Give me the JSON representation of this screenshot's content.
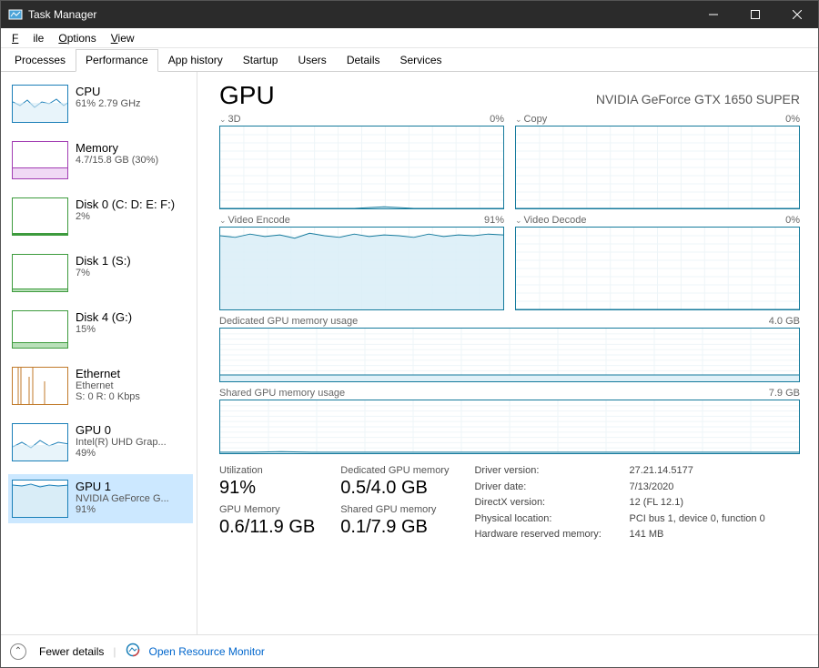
{
  "window": {
    "title": "Task Manager"
  },
  "menu": {
    "file": "File",
    "options": "Options",
    "view": "View"
  },
  "tabs": [
    "Processes",
    "Performance",
    "App history",
    "Startup",
    "Users",
    "Details",
    "Services"
  ],
  "active_tab": "Performance",
  "sidebar": [
    {
      "title": "CPU",
      "sub": "61% 2.79 GHz",
      "color": "#1a7fb8"
    },
    {
      "title": "Memory",
      "sub": "4.7/15.8 GB (30%)",
      "color": "#a23db3"
    },
    {
      "title": "Disk 0 (C: D: E: F:)",
      "sub": "2%",
      "color": "#3d9b3d"
    },
    {
      "title": "Disk 1 (S:)",
      "sub": "7%",
      "color": "#3d9b3d"
    },
    {
      "title": "Disk 4 (G:)",
      "sub": "15%",
      "color": "#3d9b3d"
    },
    {
      "title": "Ethernet",
      "sub": "Ethernet",
      "sub2": "S: 0 R: 0 Kbps",
      "color": "#c17a2a"
    },
    {
      "title": "GPU 0",
      "sub": "Intel(R) UHD Grap...",
      "sub2": "49%",
      "color": "#1a7fb8"
    },
    {
      "title": "GPU 1",
      "sub": "NVIDIA GeForce G...",
      "sub2": "91%",
      "color": "#1a7fb8",
      "selected": true
    }
  ],
  "main": {
    "title": "GPU",
    "subtitle": "NVIDIA GeForce GTX 1650 SUPER",
    "engines": [
      {
        "name": "3D",
        "pct": "0%"
      },
      {
        "name": "Copy",
        "pct": "0%"
      },
      {
        "name": "Video Encode",
        "pct": "91%"
      },
      {
        "name": "Video Decode",
        "pct": "0%"
      }
    ],
    "mem": [
      {
        "name": "Dedicated GPU memory usage",
        "max": "4.0 GB"
      },
      {
        "name": "Shared GPU memory usage",
        "max": "7.9 GB"
      }
    ],
    "stats": {
      "utilization_lbl": "Utilization",
      "utilization": "91%",
      "gpumem_lbl": "GPU Memory",
      "gpumem": "0.6/11.9 GB",
      "dedmem_lbl": "Dedicated GPU memory",
      "dedmem": "0.5/4.0 GB",
      "shmem_lbl": "Shared GPU memory",
      "shmem": "0.1/7.9 GB"
    },
    "kv": {
      "driver_version_k": "Driver version:",
      "driver_version_v": "27.21.14.5177",
      "driver_date_k": "Driver date:",
      "driver_date_v": "7/13/2020",
      "directx_k": "DirectX version:",
      "directx_v": "12 (FL 12.1)",
      "location_k": "Physical location:",
      "location_v": "PCI bus 1, device 0, function 0",
      "hwres_k": "Hardware reserved memory:",
      "hwres_v": "141 MB"
    }
  },
  "footer": {
    "fewer": "Fewer details",
    "monitor": "Open Resource Monitor"
  },
  "chart_data": {
    "type": "line",
    "note": "Approximate utilization traces over ~60s",
    "engines": {
      "3D": [
        0,
        0,
        0,
        0,
        0,
        0,
        0,
        0,
        0,
        0,
        1,
        2,
        1,
        0,
        0,
        0,
        0,
        0,
        0,
        0
      ],
      "Copy": [
        0,
        0,
        0,
        0,
        0,
        0,
        0,
        0,
        0,
        0,
        0,
        0,
        0,
        0,
        0,
        0,
        0,
        0,
        0,
        0
      ],
      "Video Encode": [
        90,
        88,
        92,
        89,
        91,
        87,
        93,
        90,
        88,
        92,
        89,
        91,
        90,
        88,
        92,
        89,
        91,
        90,
        92,
        91
      ],
      "Video Decode": [
        0,
        0,
        0,
        0,
        0,
        0,
        0,
        0,
        0,
        0,
        0,
        0,
        0,
        0,
        0,
        0,
        0,
        0,
        0,
        0
      ]
    },
    "dedicated_mem_pct": [
      12,
      12,
      12,
      12,
      12,
      12,
      12,
      12,
      12,
      12,
      12,
      12,
      12,
      12,
      12,
      12,
      12,
      12,
      12,
      12
    ],
    "shared_mem_pct": [
      2,
      2,
      3,
      2,
      2,
      2,
      2,
      2,
      2,
      2,
      2,
      2,
      2,
      2,
      2,
      2,
      2,
      2,
      2,
      2
    ],
    "y_range": [
      0,
      100
    ]
  }
}
